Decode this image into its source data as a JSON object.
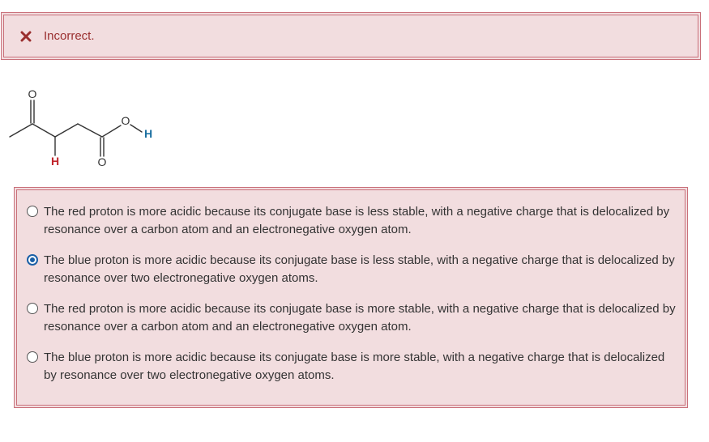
{
  "feedback": {
    "status_text": "Incorrect.",
    "icon": "x-mark-icon",
    "color": "#9a2f2f"
  },
  "molecule": {
    "atom_labels": {
      "ketone_oxygen": "O",
      "acid_carbonyl_oxygen": "O",
      "hydroxyl_oxygen": "O",
      "red_proton": "H",
      "blue_proton": "H"
    },
    "colors": {
      "red_proton": "#c0242b",
      "blue_proton": "#1a6fa0"
    }
  },
  "question": {
    "options": [
      {
        "label": "The red proton is more acidic because its conjugate base is less stable, with a negative charge that is delocalized by resonance over a carbon atom and an electronegative oxygen atom.",
        "selected": false
      },
      {
        "label": "The blue proton is more acidic because its conjugate base is less stable, with a negative charge that is delocalized by resonance over two electronegative oxygen atoms.",
        "selected": true
      },
      {
        "label": "The red proton is more acidic because its conjugate base is more stable, with a negative charge that is delocalized by resonance over a carbon atom and an electronegative oxygen atom.",
        "selected": false
      },
      {
        "label": "The blue proton is more acidic because its conjugate base is more stable, with a negative charge that is delocalized by resonance over two electronegative oxygen atoms.",
        "selected": false
      }
    ]
  },
  "colors": {
    "panel_background": "#f2dddf",
    "panel_border": "#c9707a",
    "radio_selected": "#1a5fa6"
  }
}
